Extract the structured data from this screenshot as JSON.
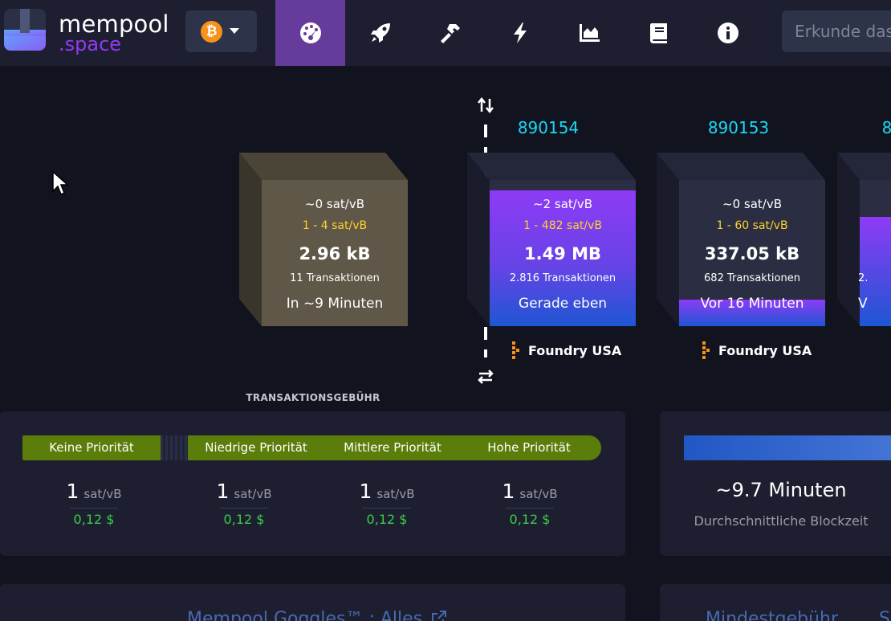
{
  "logo": {
    "line1": "mempool",
    "line2": ".space"
  },
  "network": {
    "symbol": "₿",
    "coin_icon": "bitcoin-icon",
    "color": "#f7931a"
  },
  "nav": {
    "items": [
      {
        "icon": "dashboard-icon",
        "active": true
      },
      {
        "icon": "rocket-icon",
        "active": false
      },
      {
        "icon": "hammer-icon",
        "active": false
      },
      {
        "icon": "lightning-icon",
        "active": false
      },
      {
        "icon": "chart-icon",
        "active": false
      },
      {
        "icon": "book-icon",
        "active": false
      },
      {
        "icon": "info-icon",
        "active": false
      }
    ],
    "active_color": "#653b9c"
  },
  "search": {
    "placeholder": "Erkunde das"
  },
  "mempool_block": {
    "median_fee": "~0 sat/vB",
    "fee_range": "1 - 4 sat/vB",
    "size": "2.96 kB",
    "tx_count": "11 Transaktionen",
    "eta": "In ~9 Minuten"
  },
  "blocks": [
    {
      "height": "890154",
      "median_fee": "~2 sat/vB",
      "fee_range": "1 - 482 sat/vB",
      "size": "1.49 MB",
      "tx_count": "2.816 Transaktionen",
      "time": "Gerade eben",
      "pool": "Foundry USA"
    },
    {
      "height": "890153",
      "median_fee": "~0 sat/vB",
      "fee_range": "1 - 60 sat/vB",
      "size": "337.05 kB",
      "tx_count": "682 Transaktionen",
      "time": "Vor 16 Minuten",
      "pool": "Foundry USA"
    },
    {
      "height": "8",
      "tx_count": "2.",
      "time": "V"
    }
  ],
  "fees": {
    "heading": "TRANSAKTIONSGEBÜHR",
    "priorities": [
      {
        "label": "Keine Priorität",
        "value": "1",
        "unit": "sat/vB",
        "usd": "0,12 $"
      },
      {
        "label": "Niedrige Priorität",
        "value": "1",
        "unit": "sat/vB",
        "usd": "0,12 $"
      },
      {
        "label": "Mittlere Priorität",
        "value": "1",
        "unit": "sat/vB",
        "usd": "0,12 $"
      },
      {
        "label": "Hohe Priorität",
        "value": "1",
        "unit": "sat/vB",
        "usd": "0,12 $"
      }
    ],
    "bar_color": "#5b7d0a"
  },
  "blocktime": {
    "value": "~9.7 Minuten",
    "label": "Durchschnittliche Blockzeit"
  },
  "goggles": {
    "title": "Mempool Goggles™ : Alles"
  },
  "min_fee": {
    "title": "Mindestgebühr",
    "second": "S"
  }
}
